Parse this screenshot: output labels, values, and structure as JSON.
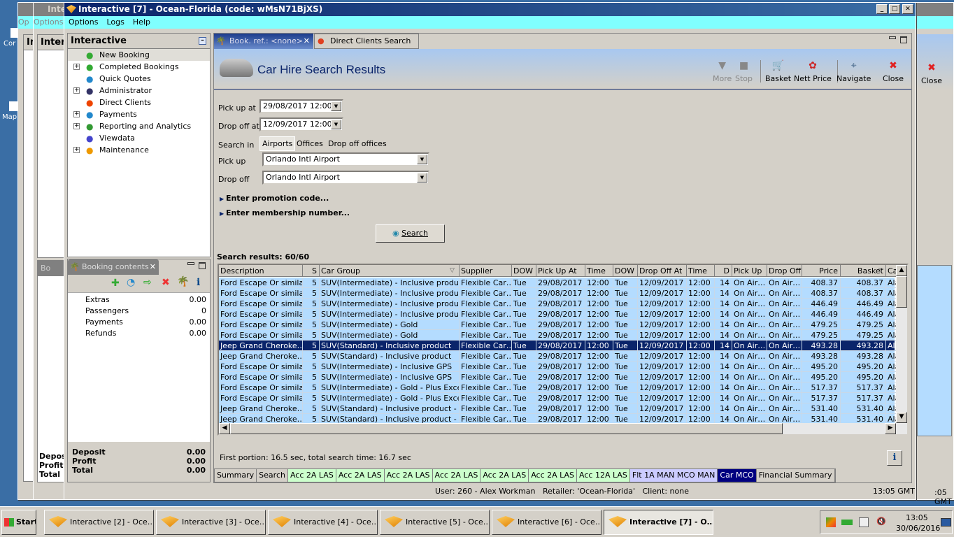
{
  "desktop": {
    "icons": [
      "Cor",
      "Map"
    ]
  },
  "back_windows": {
    "title": "Inte",
    "menu": "Options",
    "panel": "Intera",
    "menu_short": "Op",
    "panel_short": "In"
  },
  "window": {
    "title": "Interactive [7] - Ocean-Florida (code: wMsN71BjXS)",
    "menu": [
      "Options",
      "Logs",
      "Help"
    ]
  },
  "nav": {
    "title": "Interactive",
    "items": [
      {
        "label": "New Booking",
        "icon": "palm-tree-icon",
        "expand": false
      },
      {
        "label": "Completed Bookings",
        "icon": "completed-bookings-icon",
        "expand": true
      },
      {
        "label": "Quick Quotes",
        "icon": "clock-icon",
        "expand": false
      },
      {
        "label": "Administrator",
        "icon": "runner-icon",
        "expand": true
      },
      {
        "label": "Direct Clients",
        "icon": "clients-icon",
        "expand": false
      },
      {
        "label": "Payments",
        "icon": "payments-icon",
        "expand": true
      },
      {
        "label": "Reporting and Analytics",
        "icon": "report-icon",
        "expand": true
      },
      {
        "label": "Viewdata",
        "icon": "globe-icon",
        "expand": false
      },
      {
        "label": "Maintenance",
        "icon": "maintenance-icon",
        "expand": true
      }
    ]
  },
  "booking_contents": {
    "tab": "Booking contents",
    "back_tab": "Bo",
    "rows": [
      {
        "label": "Extras",
        "value": "0.00"
      },
      {
        "label": "Passengers",
        "value": "0"
      },
      {
        "label": "Payments",
        "value": "0.00"
      },
      {
        "label": "Refunds",
        "value": "0.00"
      }
    ],
    "totals": [
      {
        "label": "Deposit",
        "value": "0.00"
      },
      {
        "label": "Profit",
        "value": "0.00"
      },
      {
        "label": "Total",
        "value": "0.00"
      }
    ]
  },
  "tabs": [
    {
      "label": "Book. ref.: <none>",
      "active": true
    },
    {
      "label": "Direct Clients Search",
      "active": false
    }
  ],
  "header": {
    "title": "Car Hire Search Results",
    "toolbar": [
      {
        "label": "More",
        "icon": "triangle-down-icon",
        "disabled": true
      },
      {
        "label": "Stop",
        "icon": "stop-icon",
        "disabled": true
      },
      {
        "label": "Basket",
        "icon": "basket-icon"
      },
      {
        "label": "Nett Price",
        "icon": "nett-price-icon"
      },
      {
        "label": "Navigate",
        "icon": "compass-icon"
      },
      {
        "label": "Close",
        "icon": "close-icon"
      }
    ],
    "back_close": "Close"
  },
  "form": {
    "pickup_at_label": "Pick up at",
    "pickup_at": "29/08/2017 12:00",
    "dropoff_at_label": "Drop off at",
    "dropoff_at": "12/09/2017 12:00",
    "search_in_label": "Search in",
    "search_in_options": [
      "Airports",
      "Offices",
      "Drop off offices"
    ],
    "search_in_selected": "Airports",
    "pickup_label": "Pick up",
    "pickup": "Orlando Intl Airport",
    "dropoff_label": "Drop off",
    "dropoff": "Orlando Intl Airport",
    "promo": "Enter promotion code...",
    "membership": "Enter membership number...",
    "search_button": "Search"
  },
  "results": {
    "count_label": "Search results: 60/60",
    "columns": [
      "Description",
      "S",
      "Car Group",
      "Supplier",
      "DOW",
      "Pick Up At",
      "Time",
      "DOW",
      "Drop Off At",
      "Time",
      "D",
      "Pick Up",
      "Drop Off",
      "Price",
      "Basket",
      "Ca"
    ],
    "selected_row": 6,
    "rows": [
      [
        "Ford Escape Or simila…",
        "5",
        "SUV(Intermediate) - Inclusive product",
        "Flexible Car…",
        "Tue",
        "29/08/2017",
        "12:00",
        "Tue",
        "12/09/2017",
        "12:00",
        "14",
        "On Air…",
        "On Air…",
        "408.37",
        "408.37",
        "Ala"
      ],
      [
        "Ford Escape Or simila…",
        "5",
        "SUV(Intermediate) - Inclusive product",
        "Flexible Car…",
        "Tue",
        "29/08/2017",
        "12:00",
        "Tue",
        "12/09/2017",
        "12:00",
        "14",
        "On Air…",
        "On Air…",
        "408.37",
        "408.37",
        "Ala"
      ],
      [
        "Ford Escape Or simila…",
        "5",
        "SUV(Intermediate) - Inclusive product…",
        "Flexible Car…",
        "Tue",
        "29/08/2017",
        "12:00",
        "Tue",
        "12/09/2017",
        "12:00",
        "14",
        "On Air…",
        "On Air…",
        "446.49",
        "446.49",
        "Ala"
      ],
      [
        "Ford Escape Or simila…",
        "5",
        "SUV(Intermediate) - Inclusive product…",
        "Flexible Car…",
        "Tue",
        "29/08/2017",
        "12:00",
        "Tue",
        "12/09/2017",
        "12:00",
        "14",
        "On Air…",
        "On Air…",
        "446.49",
        "446.49",
        "Ala"
      ],
      [
        "Ford Escape Or simila…",
        "5",
        "SUV(Intermediate) - Gold",
        "Flexible Car…",
        "Tue",
        "29/08/2017",
        "12:00",
        "Tue",
        "12/09/2017",
        "12:00",
        "14",
        "On Air…",
        "On Air…",
        "479.25",
        "479.25",
        "Ala"
      ],
      [
        "Ford Escape Or simila…",
        "5",
        "SUV(Intermediate) - Gold",
        "Flexible Car…",
        "Tue",
        "29/08/2017",
        "12:00",
        "Tue",
        "12/09/2017",
        "12:00",
        "14",
        "On Air…",
        "On Air…",
        "479.25",
        "479.25",
        "Ala"
      ],
      [
        "Jeep Grand Cheroke…",
        "5",
        "SUV(Standard) - Inclusive product",
        "Flexible Car…",
        "Tue",
        "29/08/2017",
        "12:00",
        "Tue",
        "12/09/2017",
        "12:00",
        "14",
        "On Air…",
        "On Air…",
        "493.28",
        "493.28",
        "Ala"
      ],
      [
        "Jeep Grand Cheroke…",
        "5",
        "SUV(Standard) - Inclusive product",
        "Flexible Car…",
        "Tue",
        "29/08/2017",
        "12:00",
        "Tue",
        "12/09/2017",
        "12:00",
        "14",
        "On Air…",
        "On Air…",
        "493.28",
        "493.28",
        "Ala"
      ],
      [
        "Ford Escape Or simila…",
        "5",
        "SUV(Intermediate) - Inclusive GPS",
        "Flexible Car…",
        "Tue",
        "29/08/2017",
        "12:00",
        "Tue",
        "12/09/2017",
        "12:00",
        "14",
        "On Air…",
        "On Air…",
        "495.20",
        "495.20",
        "Ala"
      ],
      [
        "Ford Escape Or simila…",
        "5",
        "SUV(Intermediate) - Inclusive GPS",
        "Flexible Car…",
        "Tue",
        "29/08/2017",
        "12:00",
        "Tue",
        "12/09/2017",
        "12:00",
        "14",
        "On Air…",
        "On Air…",
        "495.20",
        "495.20",
        "Ala"
      ],
      [
        "Ford Escape Or simila…",
        "5",
        "SUV(Intermediate) - Gold - Plus Exces…",
        "Flexible Car…",
        "Tue",
        "29/08/2017",
        "12:00",
        "Tue",
        "12/09/2017",
        "12:00",
        "14",
        "On Air…",
        "On Air…",
        "517.37",
        "517.37",
        "Ala"
      ],
      [
        "Ford Escape Or simila…",
        "5",
        "SUV(Intermediate) - Gold - Plus Exces…",
        "Flexible Car…",
        "Tue",
        "29/08/2017",
        "12:00",
        "Tue",
        "12/09/2017",
        "12:00",
        "14",
        "On Air…",
        "On Air…",
        "517.37",
        "517.37",
        "Ala"
      ],
      [
        "Jeep Grand Cheroke…",
        "5",
        "SUV(Standard) - Inclusive product - Pl…",
        "Flexible Car…",
        "Tue",
        "29/08/2017",
        "12:00",
        "Tue",
        "12/09/2017",
        "12:00",
        "14",
        "On Air…",
        "On Air…",
        "531.40",
        "531.40",
        "Ala"
      ],
      [
        "Jeep Grand Cheroke…",
        "5",
        "SUV(Standard) - Inclusive product - Pl…",
        "Flexible Car…",
        "Tue",
        "29/08/2017",
        "12:00",
        "Tue",
        "12/09/2017",
        "12:00",
        "14",
        "On Air…",
        "On Air…",
        "531.40",
        "531.40",
        "Ala"
      ]
    ],
    "timing": "First portion: 16.5 sec, total search time: 16.7 sec"
  },
  "bottom_tabs": [
    {
      "label": "Summary",
      "color": "#d4d0c8"
    },
    {
      "label": "Search",
      "color": "#d4d0c8"
    },
    {
      "label": "Acc 2A LAS",
      "color": "#ccffcc"
    },
    {
      "label": "Acc 2A LAS",
      "color": "#ccffcc"
    },
    {
      "label": "Acc 2A LAS",
      "color": "#ccffcc"
    },
    {
      "label": "Acc 2A LAS",
      "color": "#ccffcc"
    },
    {
      "label": "Acc 2A LAS",
      "color": "#ccffcc"
    },
    {
      "label": "Acc 2A LAS",
      "color": "#ccffcc"
    },
    {
      "label": "Acc 12A LAS",
      "color": "#ccffcc"
    },
    {
      "label": "Flt 1A MAN MCO MAN",
      "color": "#ccccff"
    },
    {
      "label": "Car MCO",
      "color": "#000080",
      "active": true
    },
    {
      "label": "Financial Summary",
      "color": "#d4d0c8"
    }
  ],
  "status": {
    "user": "User: 260 - Alex Workman",
    "retailer": "Retailer: 'Ocean-Florida'",
    "client": "Client: none",
    "time": "13:05 GMT",
    "back_time": ":05 GMT"
  },
  "taskbar": {
    "start": "Start",
    "items": [
      {
        "label": "Interactive [2] - Oce…"
      },
      {
        "label": "Interactive [3] - Oce…"
      },
      {
        "label": "Interactive [4] - Oce…"
      },
      {
        "label": "Interactive [5] - Oce…"
      },
      {
        "label": "Interactive [6] - Oce…"
      },
      {
        "label": "Interactive [7] - O…",
        "active": true
      }
    ],
    "clock_time": "13:05",
    "clock_date": "30/06/2016"
  }
}
